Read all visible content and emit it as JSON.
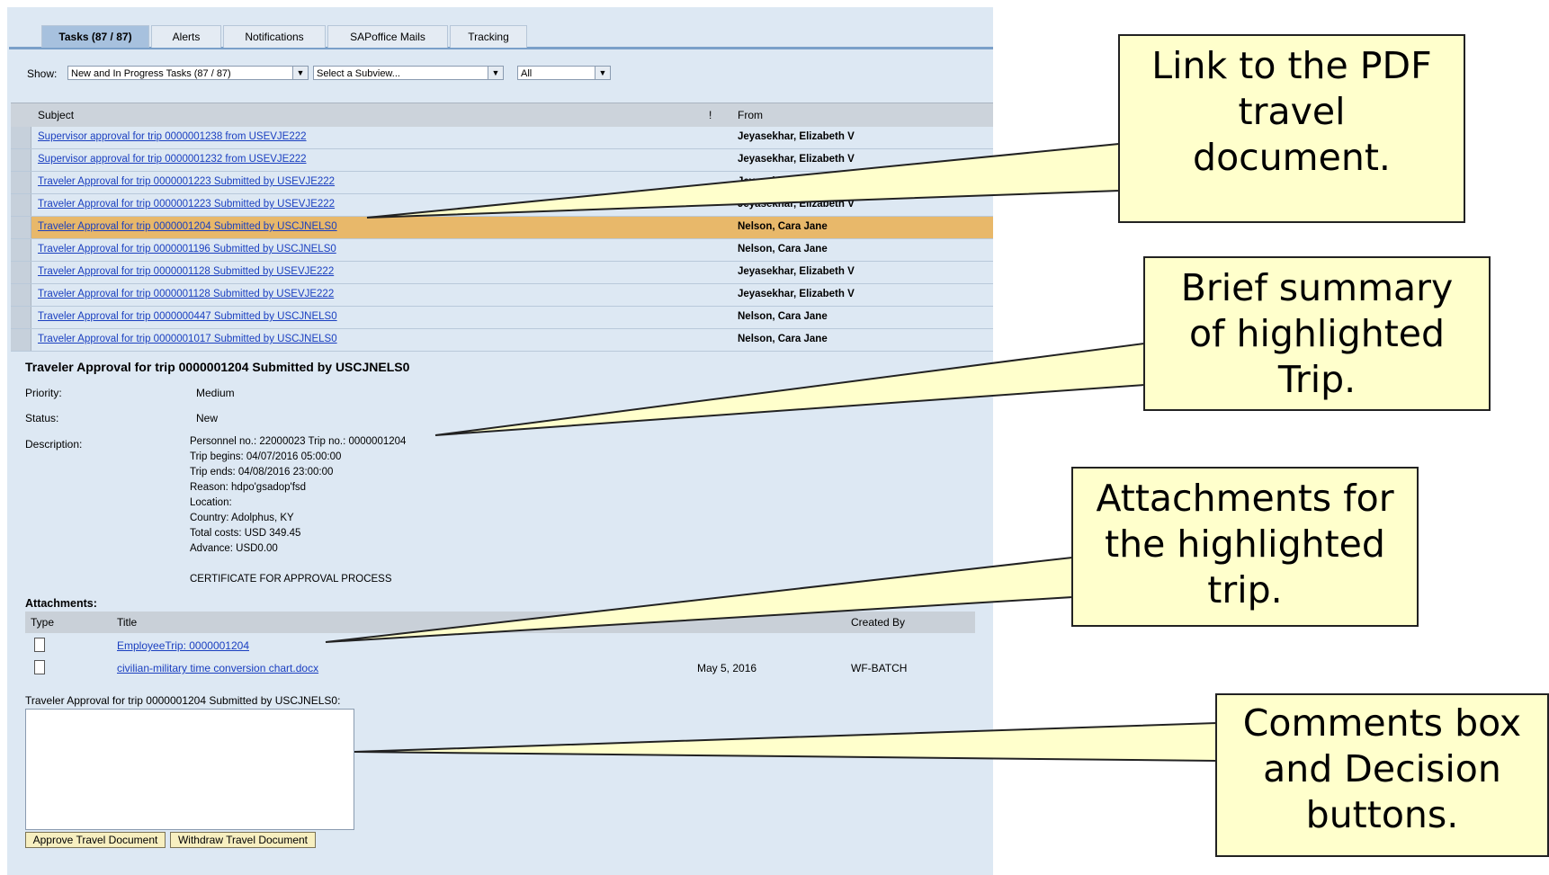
{
  "tabs": [
    {
      "label": "Tasks  (87 / 87)",
      "active": true
    },
    {
      "label": "Alerts",
      "active": false
    },
    {
      "label": "Notifications",
      "active": false
    },
    {
      "label": "SAPoffice Mails",
      "active": false
    },
    {
      "label": "Tracking",
      "active": false
    }
  ],
  "filter": {
    "show_label": "Show:",
    "show_value": "New and In Progress Tasks  (87 / 87)",
    "subview_value": "Select a Subview...",
    "all_value": "All"
  },
  "table": {
    "headers": {
      "subject": "Subject",
      "priority": "!",
      "from": "From"
    },
    "rows": [
      {
        "subject": "Supervisor approval for trip 0000001238 from USEVJE222",
        "from": "Jeyasekhar, Elizabeth V",
        "selected": false
      },
      {
        "subject": "Supervisor approval for trip 0000001232 from USEVJE222",
        "from": "Jeyasekhar, Elizabeth V",
        "selected": false
      },
      {
        "subject": "Traveler Approval for trip 0000001223 Submitted by USEVJE222",
        "from": "Jeyasekhar, Elizabeth V",
        "selected": false
      },
      {
        "subject": "Traveler Approval for trip 0000001223 Submitted by USEVJE222",
        "from": "Jeyasekhar, Elizabeth V",
        "selected": false
      },
      {
        "subject": "Traveler Approval for trip 0000001204 Submitted by USCJNELS0",
        "from": "Nelson, Cara Jane",
        "selected": true
      },
      {
        "subject": "Traveler Approval for trip 0000001196 Submitted by USCJNELS0",
        "from": "Nelson, Cara Jane",
        "selected": false
      },
      {
        "subject": "Traveler Approval for trip 0000001128 Submitted by USEVJE222",
        "from": "Jeyasekhar, Elizabeth V",
        "selected": false
      },
      {
        "subject": "Traveler Approval for trip 0000001128 Submitted by USEVJE222",
        "from": "Jeyasekhar, Elizabeth V",
        "selected": false
      },
      {
        "subject": "Traveler Approval for trip 0000000447 Submitted by USCJNELS0",
        "from": "Nelson, Cara Jane",
        "selected": false
      },
      {
        "subject": "Traveler Approval for trip 0000001017 Submitted by USCJNELS0",
        "from": "Nelson, Cara Jane",
        "selected": false
      }
    ]
  },
  "detail": {
    "title": "Traveler Approval for trip 0000001204 Submitted by USCJNELS0",
    "priority_label": "Priority:",
    "priority_value": "Medium",
    "status_label": "Status:",
    "status_value": "New",
    "description_label": "Description:",
    "description_lines": [
      "Personnel no.: 22000023 Trip no.: 0000001204",
      "Trip begins: 04/07/2016 05:00:00",
      "Trip ends: 04/08/2016 23:00:00",
      "Reason: hdpo'gsadop'fsd",
      "Location:",
      "Country: Adolphus, KY",
      "Total costs: USD 349.45",
      "Advance: USD0.00",
      "",
      "CERTIFICATE FOR APPROVAL PROCESS"
    ]
  },
  "attachments": {
    "heading": "Attachments:",
    "headers": {
      "type": "Type",
      "title": "Title",
      "created_by": "Created By"
    },
    "items": [
      {
        "title": "EmployeeTrip: 0000001204",
        "date": "",
        "created_by": ""
      },
      {
        "title": "civilian-military time conversion chart.docx",
        "date": "May 5, 2016",
        "created_by": "WF-BATCH"
      }
    ]
  },
  "comments": {
    "label": "Traveler Approval for trip 0000001204 Submitted by USCJNELS0:",
    "value": ""
  },
  "buttons": {
    "approve": "Approve Travel Document",
    "withdraw": "Withdraw Travel Document"
  },
  "callouts": [
    {
      "lines": [
        "Link to the PDF",
        "travel",
        "document."
      ]
    },
    {
      "lines": [
        "Brief summary",
        "of highlighted",
        "Trip."
      ]
    },
    {
      "lines": [
        "Attachments for",
        "the highlighted",
        "trip."
      ]
    },
    {
      "lines": [
        "Comments box",
        "and Decision",
        "buttons."
      ]
    }
  ],
  "colors": {
    "selected_row": "#e8b86a",
    "callout_fill": "#ffffcc",
    "link": "#1a3fc0",
    "panel": "#dde8f3"
  }
}
